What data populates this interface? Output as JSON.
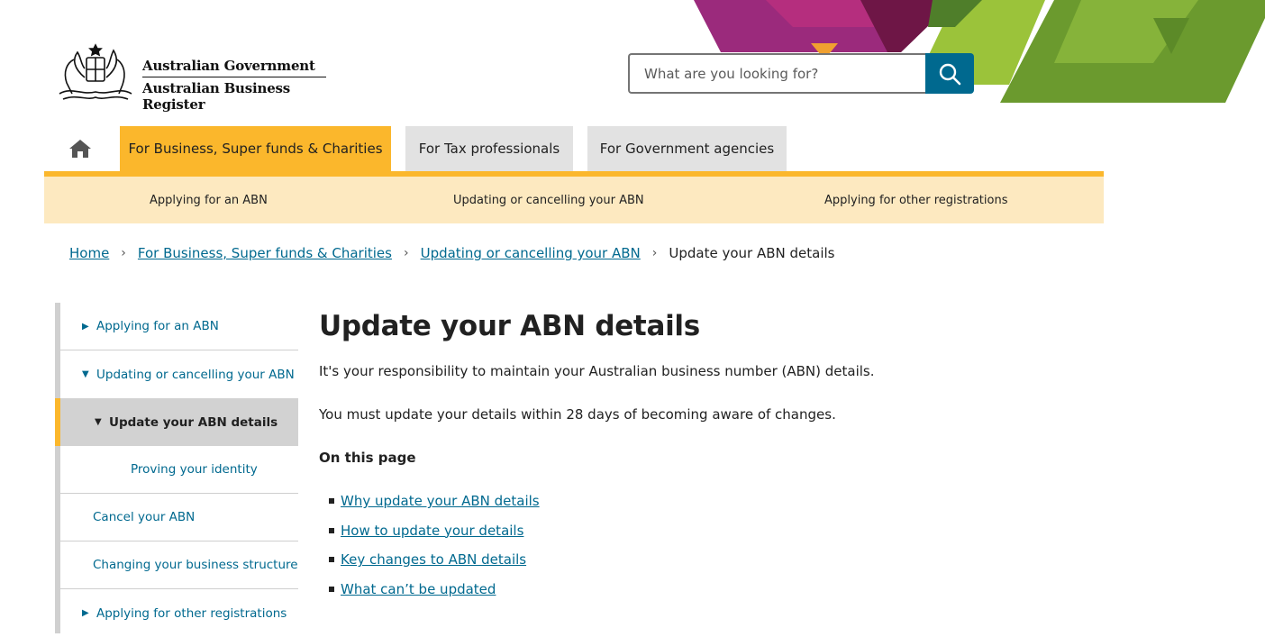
{
  "logo": {
    "line1": "Australian Government",
    "line2": "Australian Business Register"
  },
  "search": {
    "placeholder": "What are you looking for?"
  },
  "primary_nav": {
    "tabs": [
      {
        "label": "For Business, Super funds & Charities",
        "active": true
      },
      {
        "label": "For Tax professionals",
        "active": false
      },
      {
        "label": "For Government agencies",
        "active": false
      }
    ]
  },
  "secondary_nav": {
    "items": [
      "Applying for an ABN",
      "Updating or cancelling your ABN",
      "Applying for other registrations"
    ]
  },
  "breadcrumb": {
    "items": [
      "Home",
      "For Business, Super funds & Charities",
      "Updating or cancelling your ABN"
    ],
    "separator": "›",
    "current": "Update your ABN details"
  },
  "side_nav": {
    "items": [
      "Applying for an ABN",
      "Updating or cancelling your ABN",
      "Update your ABN details",
      "Proving your identity",
      "Cancel your ABN",
      "Changing your business structure",
      "Applying for other registrations"
    ]
  },
  "main": {
    "title": "Update your ABN details",
    "intro": "It's your responsibility to maintain your Australian business number (ABN) details.",
    "notice": "You must update your details within 28 days of becoming aware of changes.",
    "on_this_page": "On this page",
    "links": [
      "Why update your ABN details",
      "How to update your details",
      "Key changes to ABN details",
      "What can’t be updated"
    ]
  },
  "colors": {
    "accent_teal": "#00698f",
    "nav_yellow": "#fbb72c",
    "subnav_cream": "#fde9c0",
    "inactive_tab": "#e2e2e2"
  }
}
